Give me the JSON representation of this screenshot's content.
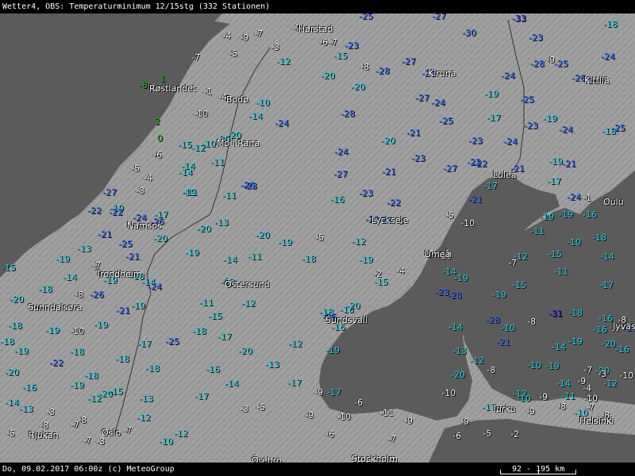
{
  "header": {
    "title": "Wetter4, OBS: Temperaturminimum 12/15stg (332 Stationen)"
  },
  "footer": {
    "timestamp": "Do, 09.02.2017 06:00z (c) MeteoGroup",
    "scale": "92 - 195 km"
  },
  "colors": {
    "land": "#9a9a9a",
    "sea": "#5b5b5b",
    "white_class": "#ffffff",
    "cyan_class": "#1ad1e6",
    "blue_class": "#2b62ff",
    "navy_class": "#1a1ad8",
    "green_class": "#11b011"
  },
  "cities": [
    "Harstad",
    "Røstlandet",
    "Bodø",
    "Mo i Rana",
    "Kiruna",
    "Kittilä",
    "Luleå",
    "Oulu",
    "Namsos",
    "Trondheim",
    "Lycksele",
    "Umeå",
    "Östersund",
    "Sunndalsøra",
    "Sundsvall",
    "Jyväskylä",
    "Rjukan",
    "Oslo",
    "Örebro",
    "Stockholm",
    "Turku",
    "Helsinki"
  ],
  "observations": [
    {
      "v": "-4",
      "c": "white"
    },
    {
      "v": "-9",
      "c": "white"
    },
    {
      "v": "-7",
      "c": "white"
    },
    {
      "v": "-7",
      "c": "white"
    },
    {
      "v": "-25",
      "c": "blue"
    },
    {
      "v": "-27",
      "c": "blue"
    },
    {
      "v": "-33",
      "c": "navy"
    },
    {
      "v": "-18",
      "c": "cyan"
    },
    {
      "v": "-3",
      "c": "white"
    },
    {
      "v": "-5",
      "c": "white"
    },
    {
      "v": "-6",
      "c": "white"
    },
    {
      "v": "-7",
      "c": "white"
    },
    {
      "v": "-23",
      "c": "blue"
    },
    {
      "v": "-30",
      "c": "blue"
    },
    {
      "v": "-23",
      "c": "blue"
    },
    {
      "v": "-7",
      "c": "white"
    },
    {
      "v": "-12",
      "c": "cyan"
    },
    {
      "v": "-15",
      "c": "cyan"
    },
    {
      "v": "-8",
      "c": "white"
    },
    {
      "v": "-28",
      "c": "blue"
    },
    {
      "v": "-27",
      "c": "blue"
    },
    {
      "v": "-21",
      "c": "blue"
    },
    {
      "v": "-9",
      "c": "white"
    },
    {
      "v": "-25",
      "c": "blue"
    },
    {
      "v": "-24",
      "c": "blue"
    },
    {
      "v": "-28",
      "c": "blue"
    },
    {
      "v": "1",
      "c": "green"
    },
    {
      "v": "-20",
      "c": "cyan"
    },
    {
      "v": "-20",
      "c": "cyan"
    },
    {
      "v": "-24",
      "c": "blue"
    },
    {
      "v": "-26",
      "c": "blue"
    },
    {
      "v": "-24",
      "c": "blue"
    },
    {
      "v": "-8",
      "c": "green"
    },
    {
      "v": "-1",
      "c": "white"
    },
    {
      "v": "-4",
      "c": "white"
    },
    {
      "v": "-10",
      "c": "cyan"
    },
    {
      "v": "-27",
      "c": "blue"
    },
    {
      "v": "-24",
      "c": "blue"
    },
    {
      "v": "-19",
      "c": "cyan"
    },
    {
      "v": "-25",
      "c": "blue"
    },
    {
      "v": "-10",
      "c": "white"
    },
    {
      "v": "-14",
      "c": "cyan"
    },
    {
      "v": "-24",
      "c": "blue"
    },
    {
      "v": "-28",
      "c": "blue"
    },
    {
      "v": "-25",
      "c": "blue"
    },
    {
      "v": "-17",
      "c": "cyan"
    },
    {
      "v": "-23",
      "c": "blue"
    },
    {
      "v": "-19",
      "c": "cyan"
    },
    {
      "v": "2",
      "c": "green"
    },
    {
      "v": "-15",
      "c": "cyan"
    },
    {
      "v": "-20",
      "c": "cyan"
    },
    {
      "v": "-20",
      "c": "cyan"
    },
    {
      "v": "-21",
      "c": "blue"
    },
    {
      "v": "-23",
      "c": "blue"
    },
    {
      "v": "-24",
      "c": "blue"
    },
    {
      "v": "-18",
      "c": "cyan"
    },
    {
      "v": "-25",
      "c": "blue"
    },
    {
      "v": "0",
      "c": "green"
    },
    {
      "v": "-12",
      "c": "cyan"
    },
    {
      "v": "-10",
      "c": "cyan"
    },
    {
      "v": "-24",
      "c": "blue"
    },
    {
      "v": "-20",
      "c": "cyan"
    },
    {
      "v": "-23",
      "c": "blue"
    },
    {
      "v": "-22",
      "c": "blue"
    },
    {
      "v": "-6",
      "c": "white"
    },
    {
      "v": "-14",
      "c": "cyan"
    },
    {
      "v": "-11",
      "c": "cyan"
    },
    {
      "v": "-24",
      "c": "blue"
    },
    {
      "v": "-27",
      "c": "blue"
    },
    {
      "v": "-21",
      "c": "blue"
    },
    {
      "v": "-27",
      "c": "blue"
    },
    {
      "v": "-22",
      "c": "blue"
    },
    {
      "v": "-21",
      "c": "blue"
    },
    {
      "v": "-19",
      "c": "cyan"
    },
    {
      "v": "-21",
      "c": "blue"
    },
    {
      "v": "-5",
      "c": "white"
    },
    {
      "v": "-4",
      "c": "white"
    },
    {
      "v": "-14",
      "c": "cyan"
    },
    {
      "v": "-26",
      "c": "blue"
    },
    {
      "v": "-23",
      "c": "blue"
    },
    {
      "v": "-22",
      "c": "blue"
    },
    {
      "v": "-17",
      "c": "cyan"
    },
    {
      "v": "-17",
      "c": "cyan"
    },
    {
      "v": "-3",
      "c": "white"
    },
    {
      "v": "-19",
      "c": "cyan"
    },
    {
      "v": "-11",
      "c": "cyan"
    },
    {
      "v": "-23",
      "c": "blue"
    },
    {
      "v": "-16",
      "c": "cyan"
    },
    {
      "v": "-21",
      "c": "blue"
    },
    {
      "v": "-24",
      "c": "blue"
    },
    {
      "v": "-1",
      "c": "white"
    },
    {
      "v": "-16",
      "c": "cyan"
    },
    {
      "v": "-27",
      "c": "blue"
    },
    {
      "v": "-22",
      "c": "blue"
    },
    {
      "v": "-19",
      "c": "cyan"
    },
    {
      "v": "-11",
      "c": "cyan"
    },
    {
      "v": "-17",
      "c": "cyan"
    },
    {
      "v": "-21",
      "c": "blue"
    },
    {
      "v": "-24",
      "c": "blue"
    },
    {
      "v": "-3",
      "c": "white"
    },
    {
      "v": "-5",
      "c": "white"
    },
    {
      "v": "-10",
      "c": "white"
    },
    {
      "v": "-19",
      "c": "cyan"
    },
    {
      "v": "-19",
      "c": "cyan"
    },
    {
      "v": "-22",
      "c": "blue"
    },
    {
      "v": "-24",
      "c": "blue"
    },
    {
      "v": "-26",
      "c": "blue"
    },
    {
      "v": "-20",
      "c": "cyan"
    },
    {
      "v": "-13",
      "c": "cyan"
    },
    {
      "v": "-20",
      "c": "cyan"
    },
    {
      "v": "-19",
      "c": "cyan"
    },
    {
      "v": "-5",
      "c": "white"
    },
    {
      "v": "-12",
      "c": "cyan"
    },
    {
      "v": "-11",
      "c": "cyan"
    },
    {
      "v": "-10",
      "c": "cyan"
    },
    {
      "v": "-18",
      "c": "cyan"
    },
    {
      "v": "-21",
      "c": "blue"
    },
    {
      "v": "-20",
      "c": "cyan"
    },
    {
      "v": "-25",
      "c": "blue"
    },
    {
      "v": "-21",
      "c": "blue"
    },
    {
      "v": "-19",
      "c": "cyan"
    },
    {
      "v": "-14",
      "c": "cyan"
    },
    {
      "v": "-11",
      "c": "cyan"
    },
    {
      "v": "-18",
      "c": "cyan"
    },
    {
      "v": "-19",
      "c": "cyan"
    },
    {
      "v": "-2",
      "c": "white"
    },
    {
      "v": "-4",
      "c": "white"
    },
    {
      "v": "-7",
      "c": "white"
    },
    {
      "v": "-10",
      "c": "white"
    },
    {
      "v": "-12",
      "c": "cyan"
    },
    {
      "v": "-15",
      "c": "cyan"
    },
    {
      "v": "-14",
      "c": "cyan"
    },
    {
      "v": "-15",
      "c": "cyan"
    },
    {
      "v": "-19",
      "c": "cyan"
    },
    {
      "v": "-13",
      "c": "cyan"
    },
    {
      "v": "-7",
      "c": "white"
    },
    {
      "v": "-14",
      "c": "cyan"
    },
    {
      "v": "-19",
      "c": "cyan"
    },
    {
      "v": "-18",
      "c": "cyan"
    },
    {
      "v": "-14",
      "c": "cyan"
    },
    {
      "v": "-12",
      "c": "cyan"
    },
    {
      "v": "-15",
      "c": "cyan"
    },
    {
      "v": "-14",
      "c": "cyan"
    },
    {
      "v": "-19",
      "c": "cyan"
    },
    {
      "v": "-7",
      "c": "white"
    },
    {
      "v": "-11",
      "c": "cyan"
    },
    {
      "v": "-17",
      "c": "cyan"
    },
    {
      "v": "-18",
      "c": "cyan"
    },
    {
      "v": "-8",
      "c": "white"
    },
    {
      "v": "-26",
      "c": "blue"
    },
    {
      "v": "-24",
      "c": "blue"
    },
    {
      "v": "-23",
      "c": "blue"
    },
    {
      "v": "-28",
      "c": "blue"
    },
    {
      "v": "-19",
      "c": "cyan"
    },
    {
      "v": "-15",
      "c": "cyan"
    },
    {
      "v": "-20",
      "c": "cyan"
    },
    {
      "v": "-11",
      "c": "cyan"
    },
    {
      "v": "-12",
      "c": "cyan"
    },
    {
      "v": "-19",
      "c": "cyan"
    },
    {
      "v": "-21",
      "c": "blue"
    },
    {
      "v": "-15",
      "c": "cyan"
    },
    {
      "v": "-18",
      "c": "cyan"
    },
    {
      "v": "-18",
      "c": "cyan"
    },
    {
      "v": "-20",
      "c": "cyan"
    },
    {
      "v": "-26",
      "c": "blue"
    },
    {
      "v": "-31",
      "c": "navy"
    },
    {
      "v": "-18",
      "c": "cyan"
    },
    {
      "v": "-16",
      "c": "cyan"
    },
    {
      "v": "-8",
      "c": "white"
    },
    {
      "v": "-18",
      "c": "cyan"
    },
    {
      "v": "-19",
      "c": "cyan"
    },
    {
      "v": "-10",
      "c": "white"
    },
    {
      "v": "-19",
      "c": "cyan"
    },
    {
      "v": "-18",
      "c": "cyan"
    },
    {
      "v": "-17",
      "c": "cyan"
    },
    {
      "v": "-16",
      "c": "cyan"
    },
    {
      "v": "-21",
      "c": "blue"
    },
    {
      "v": "-28",
      "c": "blue"
    },
    {
      "v": "-14",
      "c": "cyan"
    },
    {
      "v": "-14",
      "c": "cyan"
    },
    {
      "v": "-19",
      "c": "cyan"
    },
    {
      "v": "-20",
      "c": "cyan"
    },
    {
      "v": "-16",
      "c": "cyan"
    },
    {
      "v": "-18",
      "c": "cyan"
    },
    {
      "v": "-17",
      "c": "cyan"
    },
    {
      "v": "-25",
      "c": "blue"
    },
    {
      "v": "-12",
      "c": "cyan"
    },
    {
      "v": "-8",
      "c": "white"
    },
    {
      "v": "-10",
      "c": "cyan"
    },
    {
      "v": "-16",
      "c": "cyan"
    },
    {
      "v": "-21",
      "c": "blue"
    },
    {
      "v": "-19",
      "c": "cyan"
    },
    {
      "v": "-18",
      "c": "cyan"
    },
    {
      "v": "-20",
      "c": "cyan"
    },
    {
      "v": "-19",
      "c": "cyan"
    },
    {
      "v": "-13",
      "c": "cyan"
    },
    {
      "v": "-12",
      "c": "cyan"
    },
    {
      "v": "-10",
      "c": "cyan"
    },
    {
      "v": "-19",
      "c": "cyan"
    },
    {
      "v": "-20",
      "c": "cyan"
    },
    {
      "v": "-22",
      "c": "blue"
    },
    {
      "v": "-18",
      "c": "cyan"
    },
    {
      "v": "-18",
      "c": "cyan"
    },
    {
      "v": "-16",
      "c": "cyan"
    },
    {
      "v": "-13",
      "c": "cyan"
    },
    {
      "v": "-8",
      "c": "white"
    },
    {
      "v": "-12",
      "c": "cyan"
    },
    {
      "v": "-7",
      "c": "white"
    },
    {
      "v": "-20",
      "c": "cyan"
    },
    {
      "v": "-16",
      "c": "cyan"
    },
    {
      "v": "-19",
      "c": "cyan"
    },
    {
      "v": "-20",
      "c": "cyan"
    },
    {
      "v": "-14",
      "c": "cyan"
    },
    {
      "v": "-17",
      "c": "cyan"
    },
    {
      "v": "-20",
      "c": "cyan"
    },
    {
      "v": "-14",
      "c": "cyan"
    },
    {
      "v": "-9",
      "c": "white"
    },
    {
      "v": "-3",
      "c": "white"
    },
    {
      "v": "-4",
      "c": "white"
    },
    {
      "v": "-14",
      "c": "cyan"
    },
    {
      "v": "-18",
      "c": "cyan"
    },
    {
      "v": "-15",
      "c": "cyan"
    },
    {
      "v": "-17",
      "c": "cyan"
    },
    {
      "v": "-12",
      "c": "cyan"
    },
    {
      "v": "-10",
      "c": "white"
    },
    {
      "v": "-9",
      "c": "white"
    },
    {
      "v": "-11",
      "c": "cyan"
    },
    {
      "v": "-10",
      "c": "white"
    },
    {
      "v": "-12",
      "c": "cyan"
    },
    {
      "v": "-10",
      "c": "white"
    },
    {
      "v": "-13",
      "c": "cyan"
    },
    {
      "v": "-3",
      "c": "white"
    },
    {
      "v": "-13",
      "c": "cyan"
    },
    {
      "v": "-9",
      "c": "white"
    },
    {
      "v": "-17",
      "c": "cyan"
    },
    {
      "v": "-6",
      "c": "white"
    },
    {
      "v": "-17",
      "c": "cyan"
    },
    {
      "v": "-9",
      "c": "white"
    },
    {
      "v": "-10",
      "c": "cyan"
    },
    {
      "v": "-8",
      "c": "white"
    },
    {
      "v": "-7",
      "c": "white"
    },
    {
      "v": "-8",
      "c": "white"
    },
    {
      "v": "-8",
      "c": "white"
    },
    {
      "v": "-12",
      "c": "cyan"
    },
    {
      "v": "-3",
      "c": "white"
    },
    {
      "v": "-5",
      "c": "white"
    },
    {
      "v": "-9",
      "c": "white"
    },
    {
      "v": "-10",
      "c": "white"
    },
    {
      "v": "-11",
      "c": "white"
    },
    {
      "v": "-9",
      "c": "white"
    },
    {
      "v": "-9",
      "c": "white"
    },
    {
      "v": "-10",
      "c": "cyan"
    },
    {
      "v": "-8",
      "c": "white"
    },
    {
      "v": "-5",
      "c": "white"
    },
    {
      "v": "-7",
      "c": "white"
    },
    {
      "v": "-7",
      "c": "white"
    },
    {
      "v": "-7",
      "c": "white"
    },
    {
      "v": "-3",
      "c": "white"
    },
    {
      "v": "-10",
      "c": "cyan"
    },
    {
      "v": "-12",
      "c": "cyan"
    },
    {
      "v": "-6",
      "c": "white"
    },
    {
      "v": "-7",
      "c": "white"
    },
    {
      "v": "-6",
      "c": "white"
    },
    {
      "v": "-5",
      "c": "white"
    },
    {
      "v": "-2",
      "c": "white"
    }
  ]
}
